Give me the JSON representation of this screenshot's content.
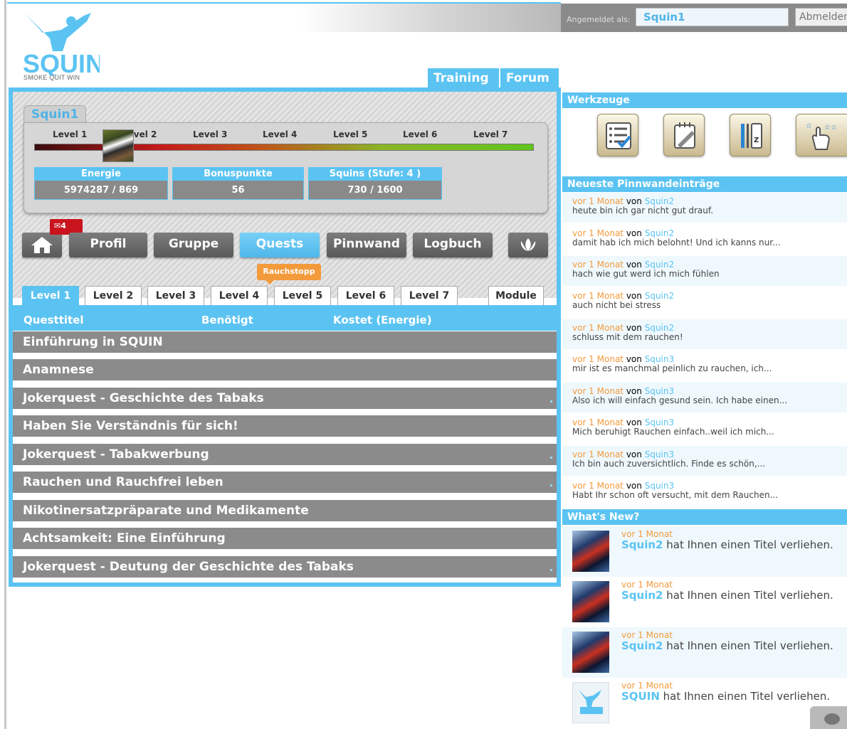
{
  "header": {
    "logo_text": "SQUIN",
    "logo_sub": "SMOKE QUIT WIN",
    "nav": [
      "Training",
      "Forum"
    ]
  },
  "login": {
    "label": "Angemeldet als:",
    "username": "Squin1",
    "logout": "Abmelden"
  },
  "profile": {
    "name": "Squin1",
    "levels": [
      "Level 1",
      "Level 2",
      "Level 3",
      "Level 4",
      "Level 5",
      "Level 6",
      "Level 7"
    ],
    "stats": [
      {
        "label": "Energie",
        "value": "5974287 / 869"
      },
      {
        "label": "Bonuspunkte",
        "value": "56"
      },
      {
        "label": "Squins (Stufe: 4 )",
        "value": "730 / 1600"
      }
    ]
  },
  "nav_buttons": {
    "home_icon": "home-icon",
    "mail_count": "4",
    "items": [
      "Profil",
      "Gruppe",
      "Quests",
      "Pinnwand",
      "Logbuch"
    ],
    "active": "Quests",
    "lotus_icon": "lotus-icon"
  },
  "quests": {
    "badge": "Rauchstopp",
    "level_tabs": [
      "Level 1",
      "Level 2",
      "Level 3",
      "Level 4",
      "Level 5",
      "Level 6",
      "Level 7"
    ],
    "module_tab": "Module",
    "columns": [
      "Questtitel",
      "Benötigt",
      "Kostet (Energie)"
    ],
    "rows": [
      "Einführung in SQUIN",
      "Anamnese",
      "Jokerquest - Geschichte des Tabaks",
      "Haben Sie Verständnis für sich!",
      "Jokerquest - Tabakwerbung",
      "Rauchen und Rauchfrei leben",
      "Nikotinersatzpräparate und Medikamente",
      "Achtsamkeit: Eine Einführung",
      "Jokerquest - Deutung der Geschichte des Tabaks"
    ]
  },
  "sidebar": {
    "tools_title": "Werkzeuge",
    "tools": [
      "checklist-icon",
      "notepad-icon",
      "az-index-icon",
      "rating-hand-icon"
    ],
    "pinboard_title": "Neueste Pinnwandeinträge",
    "pin_entries": [
      {
        "when": "vor 1 Monat",
        "by": "von",
        "who": "Squin2",
        "text": "heute bin ich gar nicht gut drauf."
      },
      {
        "when": "vor 1 Monat",
        "by": "von",
        "who": "Squin2",
        "text": "damit hab ich mich belohnt! Und ich kanns nur..."
      },
      {
        "when": "vor 1 Monat",
        "by": "von",
        "who": "Squin2",
        "text": "hach wie gut werd ich mich fühlen"
      },
      {
        "when": "vor 1 Monat",
        "by": "von",
        "who": "Squin2",
        "text": "auch nicht bei stress"
      },
      {
        "when": "vor 1 Monat",
        "by": "von",
        "who": "Squin2",
        "text": "schluss mit dem rauchen!"
      },
      {
        "when": "vor 1 Monat",
        "by": "von",
        "who": "Squin3",
        "text": "mir ist es manchmal peinlich zu rauchen, ich..."
      },
      {
        "when": "vor 1 Monat",
        "by": "von",
        "who": "Squin3",
        "text": "Also ich will einfach gesund sein. Ich habe einen..."
      },
      {
        "when": "vor 1 Monat",
        "by": "von",
        "who": "Squin3",
        "text": "Mich beruhigt Rauchen einfach..weil ich mich..."
      },
      {
        "when": "vor 1 Monat",
        "by": "von",
        "who": "Squin3",
        "text": "Ich bin auch zuversichtlich. Finde es schön,..."
      },
      {
        "when": "vor 1 Monat",
        "by": "von",
        "who": "Squin3",
        "text": "Habt Ihr schon oft versucht, mit dem Rauchen..."
      }
    ],
    "whatsnew_title": "What's New?",
    "whatsnew": [
      {
        "when": "vor 1 Monat",
        "who": "Squin2",
        "text": "hat Ihnen einen Titel verliehen."
      },
      {
        "when": "vor 1 Monat",
        "who": "Squin2",
        "text": "hat Ihnen einen Titel verliehen."
      },
      {
        "when": "vor 1 Monat",
        "who": "Squin2",
        "text": "hat Ihnen einen Titel verliehen."
      },
      {
        "when": "vor 1 Monat",
        "who": "SQUIN",
        "text": "hat Ihnen einen Titel verliehen."
      }
    ],
    "chat_icon": "chat-icon"
  },
  "colors": {
    "accent": "#5bc3f2",
    "orange": "#f39a3c",
    "grey_row": "#8b8b8b",
    "badge_red": "#c9141e"
  }
}
